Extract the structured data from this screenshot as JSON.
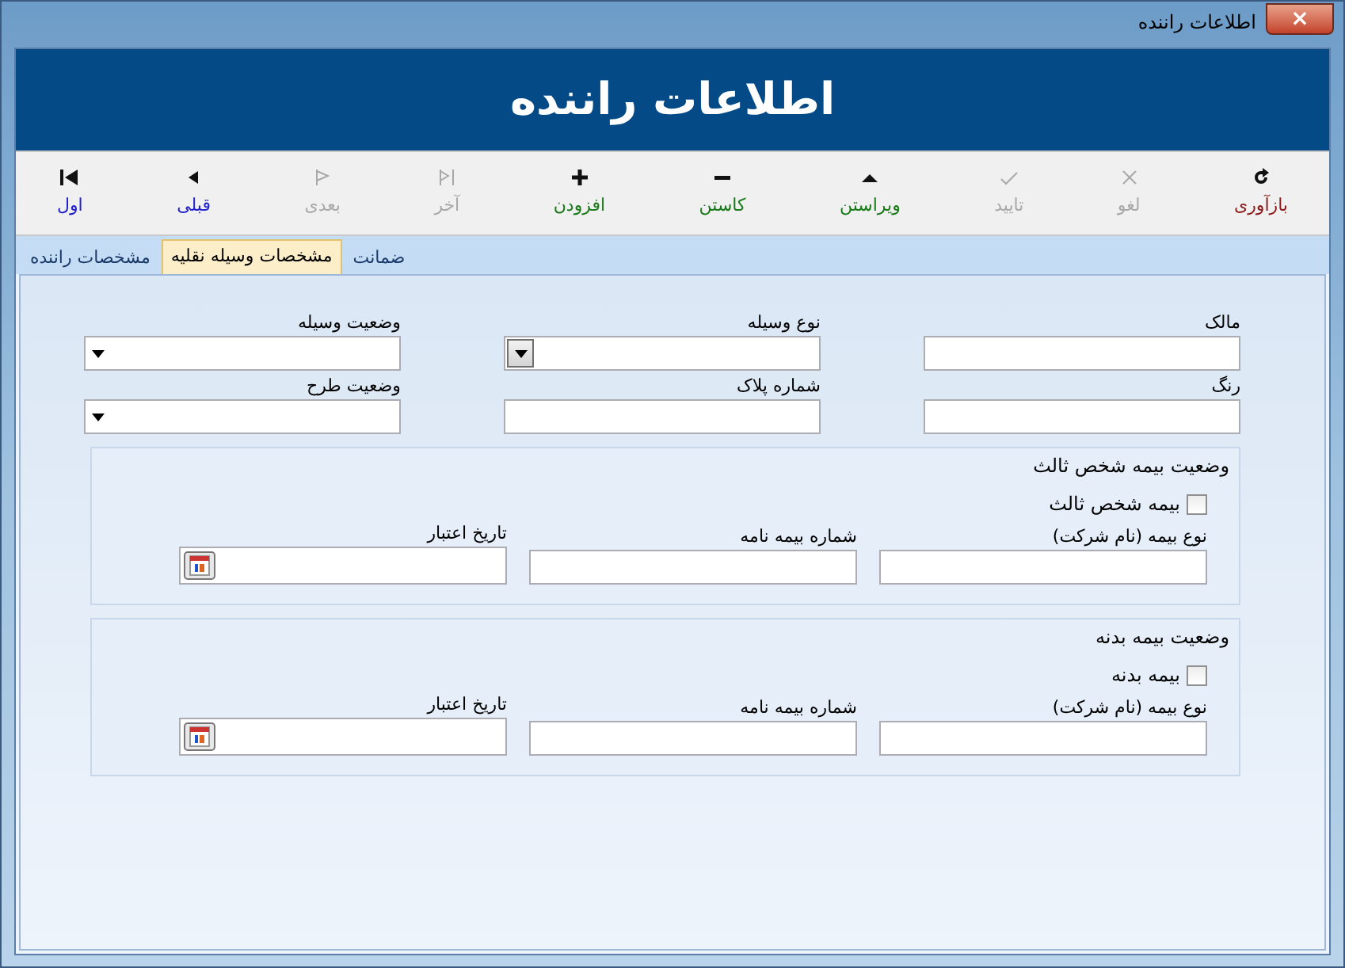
{
  "window": {
    "title": "اطلاعات راننده",
    "close": "×"
  },
  "header": {
    "title": "اطلاعات راننده"
  },
  "toolbar": [
    {
      "kind": "refresh",
      "label": "بازآوری",
      "color": "#8b1a1a",
      "disabled": false
    },
    {
      "kind": "cancel",
      "label": "لغو",
      "disabled": true
    },
    {
      "kind": "confirm",
      "label": "تایید",
      "disabled": true
    },
    {
      "kind": "up",
      "label": "ویراستن",
      "color": "#1a7a1a",
      "disabled": false
    },
    {
      "kind": "minus",
      "label": "کاستن",
      "color": "#1a7a1a",
      "disabled": false
    },
    {
      "kind": "plus",
      "label": "افزودن",
      "color": "#1a7a1a",
      "disabled": false
    },
    {
      "kind": "last",
      "label": "آخر",
      "disabled": true
    },
    {
      "kind": "next",
      "label": "بعدی",
      "disabled": true
    },
    {
      "kind": "prev",
      "label": "قبلی",
      "color": "#2222cc",
      "disabled": false
    },
    {
      "kind": "first",
      "label": "اول",
      "color": "#2222cc",
      "disabled": false
    }
  ],
  "tabs": [
    {
      "label": "ضمانت",
      "selected": false
    },
    {
      "label": "مشخصات وسیله نقلیه",
      "selected": true
    },
    {
      "label": "مشخصات راننده",
      "selected": false
    }
  ],
  "fields": [
    {
      "label": "مالک",
      "kind": "text"
    },
    {
      "label": "نوع وسیله",
      "kind": "combo"
    },
    {
      "label": "وضعیت وسیله",
      "kind": "dropdown"
    },
    {
      "label": "رنگ",
      "kind": "text"
    },
    {
      "label": "شماره پلاک",
      "kind": "text"
    },
    {
      "label": "وضعیت طرح",
      "kind": "dropdown"
    }
  ],
  "groups": [
    {
      "title": "وضعیت بیمه شخص ثالث",
      "checkbox": {
        "label": "بیمه شخص ثالث",
        "checked": false
      },
      "fields": [
        {
          "label": "نوع بیمه (نام شرکت)",
          "kind": "text"
        },
        {
          "label": "شماره بیمه نامه",
          "kind": "text"
        },
        {
          "label": "تاریخ اعتبار",
          "kind": "date"
        }
      ]
    },
    {
      "title": "وضعیت بیمه بدنه",
      "checkbox": {
        "label": "بیمه بدنه",
        "checked": false
      },
      "fields": [
        {
          "label": "نوع بیمه (نام شرکت)",
          "kind": "text"
        },
        {
          "label": "شماره بیمه نامه",
          "kind": "text"
        },
        {
          "label": "تاریخ اعتبار",
          "kind": "date"
        }
      ]
    }
  ]
}
